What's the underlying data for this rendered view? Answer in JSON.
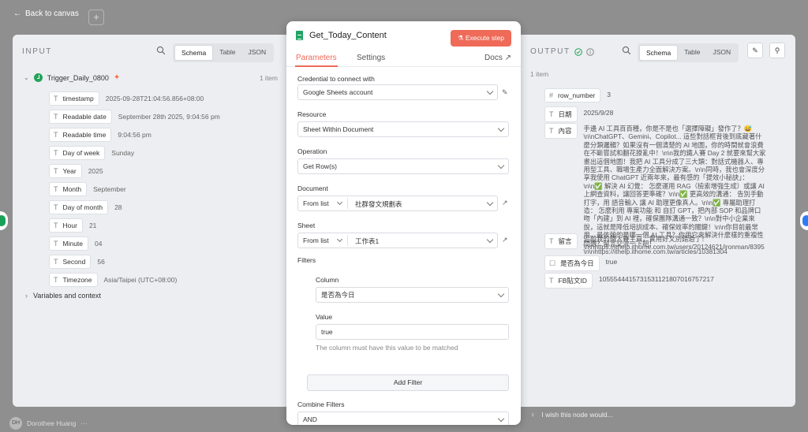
{
  "nav": {
    "back_label": "Back to canvas",
    "add_label": "+"
  },
  "input_panel": {
    "title": "INPUT",
    "views": [
      "Schema",
      "Table",
      "JSON"
    ],
    "active_view": "Schema",
    "trigger": {
      "name": "Trigger_Daily_0800",
      "count": "1 item"
    },
    "fields": [
      {
        "type": "T",
        "key": "timestamp",
        "value": "2025-09-28T21:04:56.856+08:00"
      },
      {
        "type": "T",
        "key": "Readable date",
        "value": "September 28th 2025, 9:04:56 pm"
      },
      {
        "type": "T",
        "key": "Readable time",
        "value": "9:04:56 pm"
      },
      {
        "type": "T",
        "key": "Day of week",
        "value": "Sunday"
      },
      {
        "type": "T",
        "key": "Year",
        "value": "2025"
      },
      {
        "type": "T",
        "key": "Month",
        "value": "September"
      },
      {
        "type": "T",
        "key": "Day of month",
        "value": "28"
      },
      {
        "type": "T",
        "key": "Hour",
        "value": "21"
      },
      {
        "type": "T",
        "key": "Minute",
        "value": "04"
      },
      {
        "type": "T",
        "key": "Second",
        "value": "56"
      },
      {
        "type": "T",
        "key": "Timezone",
        "value": "Asia/Taipei (UTC+08:00)"
      }
    ],
    "variables_label": "Variables and context"
  },
  "modal": {
    "title": "Get_Today_Content",
    "execute_label": "Execute step",
    "tabs": [
      "Parameters",
      "Settings"
    ],
    "docs_label": "Docs",
    "credential_label": "Credential to connect with",
    "credential_value": "Google Sheets account",
    "resource_label": "Resource",
    "resource_value": "Sheet Within Document",
    "operation_label": "Operation",
    "operation_value": "Get Row(s)",
    "document_label": "Document",
    "document_mode": "From list",
    "document_value": "社群發文規劃表",
    "sheet_label": "Sheet",
    "sheet_mode": "From list",
    "sheet_value": "工作表1",
    "filters_label": "Filters",
    "column_label": "Column",
    "column_value": "是否為今日",
    "value_label": "Value",
    "value_value": "true",
    "value_hint": "The column must have this value to be matched",
    "add_filter_label": "Add Filter",
    "combine_label": "Combine Filters",
    "combine_value": "AND"
  },
  "output_panel": {
    "title": "OUTPUT",
    "count": "1 item",
    "views": [
      "Schema",
      "Table",
      "JSON"
    ],
    "active_view": "Schema",
    "fields": [
      {
        "type": "#",
        "key": "row_number",
        "value": "3"
      },
      {
        "type": "T",
        "key": "日期",
        "value": "2025/9/28"
      },
      {
        "type": "T",
        "key": "內容",
        "value": "手邊 AI 工具百百種，你是不是也「選擇障礙」發作了？😅 \\n\\nChatGPT、Gemini、Copilot... 這些對話框背後到底藏著什麼分類邏輯？如果沒有一個清楚的 AI 地圖，你的時間就會浪費在不斷嘗試和翻花撩亂中！\\n\\n我的鐵人賽 Day 2 就要來幫大家畫出這個地圖！我把 AI 工具分成了三大類：對話式機器人、專用型工具、職場生產力全面解決方案。\\n\\n同時，我也會深度分享我使用 ChatGPT 近兩年來，最有感的「提效小秘訣」：\\n\\n✅ 解決 AI 幻覺： 怎麼運用 RAG（檢索增強生成）或讓 AI 上網查資料，讓回答更準確？\\n\\n✅ 更高效的溝通： 告別手動打字，用 語音輸入 讓 AI 助理更像真人。\\n\\n✅ 專屬助理打造： 怎麼利用 專案功能 和 自訂 GPT，把內部 SOP 和品牌口吻「內建」到 AI 裡，確保團隊溝通一致？\\n\\n對中小企業來說，這就是降低培訓成本、確保效率的關鍵！\\n\\n你目前最常用，最依賴的是哪一個 AI 工具？你用它來解決什麼樣的重複性問題？留言交流一下吧！\\n\\nhttps://ithelp.ithome.com.tw/articles/10381304"
      },
      {
        "type": "T",
        "key": "留言",
        "value": "追蹤我的鐵人賽主頁，實用好文別錯過了！\\n\\nhttps://ithelp.ithome.com.tw/users/20124621/ironman/8395"
      },
      {
        "type": "☐",
        "key": "是否為今日",
        "value": "true"
      },
      {
        "type": "T",
        "key": "FB貼文ID",
        "value": "1055544415731531121807016757217"
      }
    ]
  },
  "footer": {
    "wish_label": "I wish this node would...",
    "user_name": "Dorothee Huang",
    "user_initials": "DH"
  }
}
